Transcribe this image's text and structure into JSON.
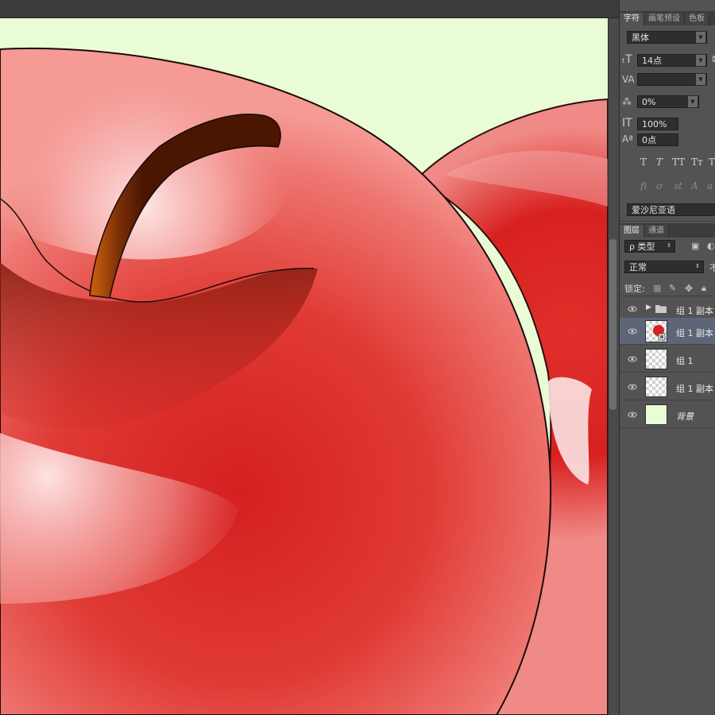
{
  "character_panel": {
    "tabs": [
      "字符",
      "画笔预设",
      "色板"
    ],
    "font_family": "黑体",
    "font_size": "14点",
    "tracking": "0%",
    "vertical_scale": "100%",
    "baseline_shift": "0点",
    "format_buttons": [
      "T",
      "T",
      "TT",
      "Tт",
      "T"
    ],
    "ligature_buttons": [
      "fi",
      "ơ",
      "st",
      "A",
      "a"
    ],
    "language": "爱沙尼亚语"
  },
  "layers_panel": {
    "tabs": [
      "图层",
      "通道"
    ],
    "filter_label": "ρ 类型",
    "blend_mode": "正常",
    "opacity_label": "不",
    "lock_label": "锁定:",
    "layers": [
      {
        "name": "组 1 副本",
        "type": "group",
        "selected": false
      },
      {
        "name": "组 1 副本",
        "type": "smart-object",
        "selected": true
      },
      {
        "name": "组 1",
        "type": "pixel",
        "selected": false
      },
      {
        "name": "组 1 副本",
        "type": "pixel",
        "selected": false
      },
      {
        "name": "背景",
        "type": "background",
        "selected": false
      }
    ]
  },
  "colors": {
    "canvas_background": "#e9fcd6",
    "apple_red": "#d8211f",
    "stem_brown": "#7a2f05",
    "selected_layer": "#5c6677"
  }
}
